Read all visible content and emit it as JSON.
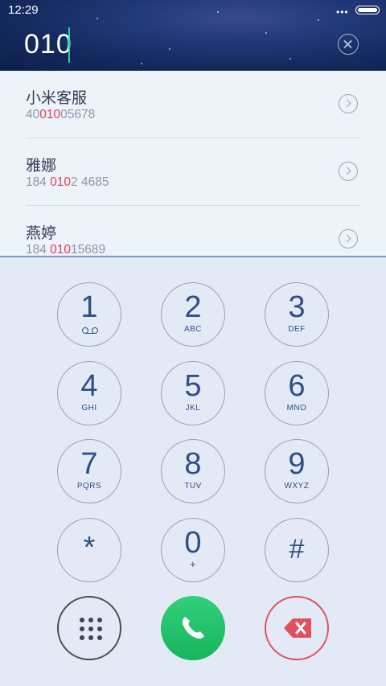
{
  "status_bar": {
    "time": "12:29",
    "overflow": "•••"
  },
  "dialer": {
    "input_value": "010"
  },
  "results": [
    {
      "name": "小米客服",
      "number_parts": [
        "40",
        "010",
        "05678"
      ]
    },
    {
      "name": "雅娜",
      "number_parts": [
        "184 ",
        "010",
        "2 4685"
      ]
    },
    {
      "name": "燕婷",
      "number_parts": [
        "184 ",
        "010",
        "15689"
      ]
    }
  ],
  "keys": [
    {
      "digit": "1",
      "letters": ""
    },
    {
      "digit": "2",
      "letters": "ABC"
    },
    {
      "digit": "3",
      "letters": "DEF"
    },
    {
      "digit": "4",
      "letters": "GHI"
    },
    {
      "digit": "5",
      "letters": "JKL"
    },
    {
      "digit": "6",
      "letters": "MNO"
    },
    {
      "digit": "7",
      "letters": "PQRS"
    },
    {
      "digit": "8",
      "letters": "TUV"
    },
    {
      "digit": "9",
      "letters": "WXYZ"
    },
    {
      "digit": "*",
      "letters": ""
    },
    {
      "digit": "0",
      "letters": "+"
    },
    {
      "digit": "#",
      "letters": ""
    }
  ],
  "colors": {
    "accent_green": "#1fbf68",
    "highlight_red": "#e2405a",
    "key_blue": "#304f86"
  }
}
